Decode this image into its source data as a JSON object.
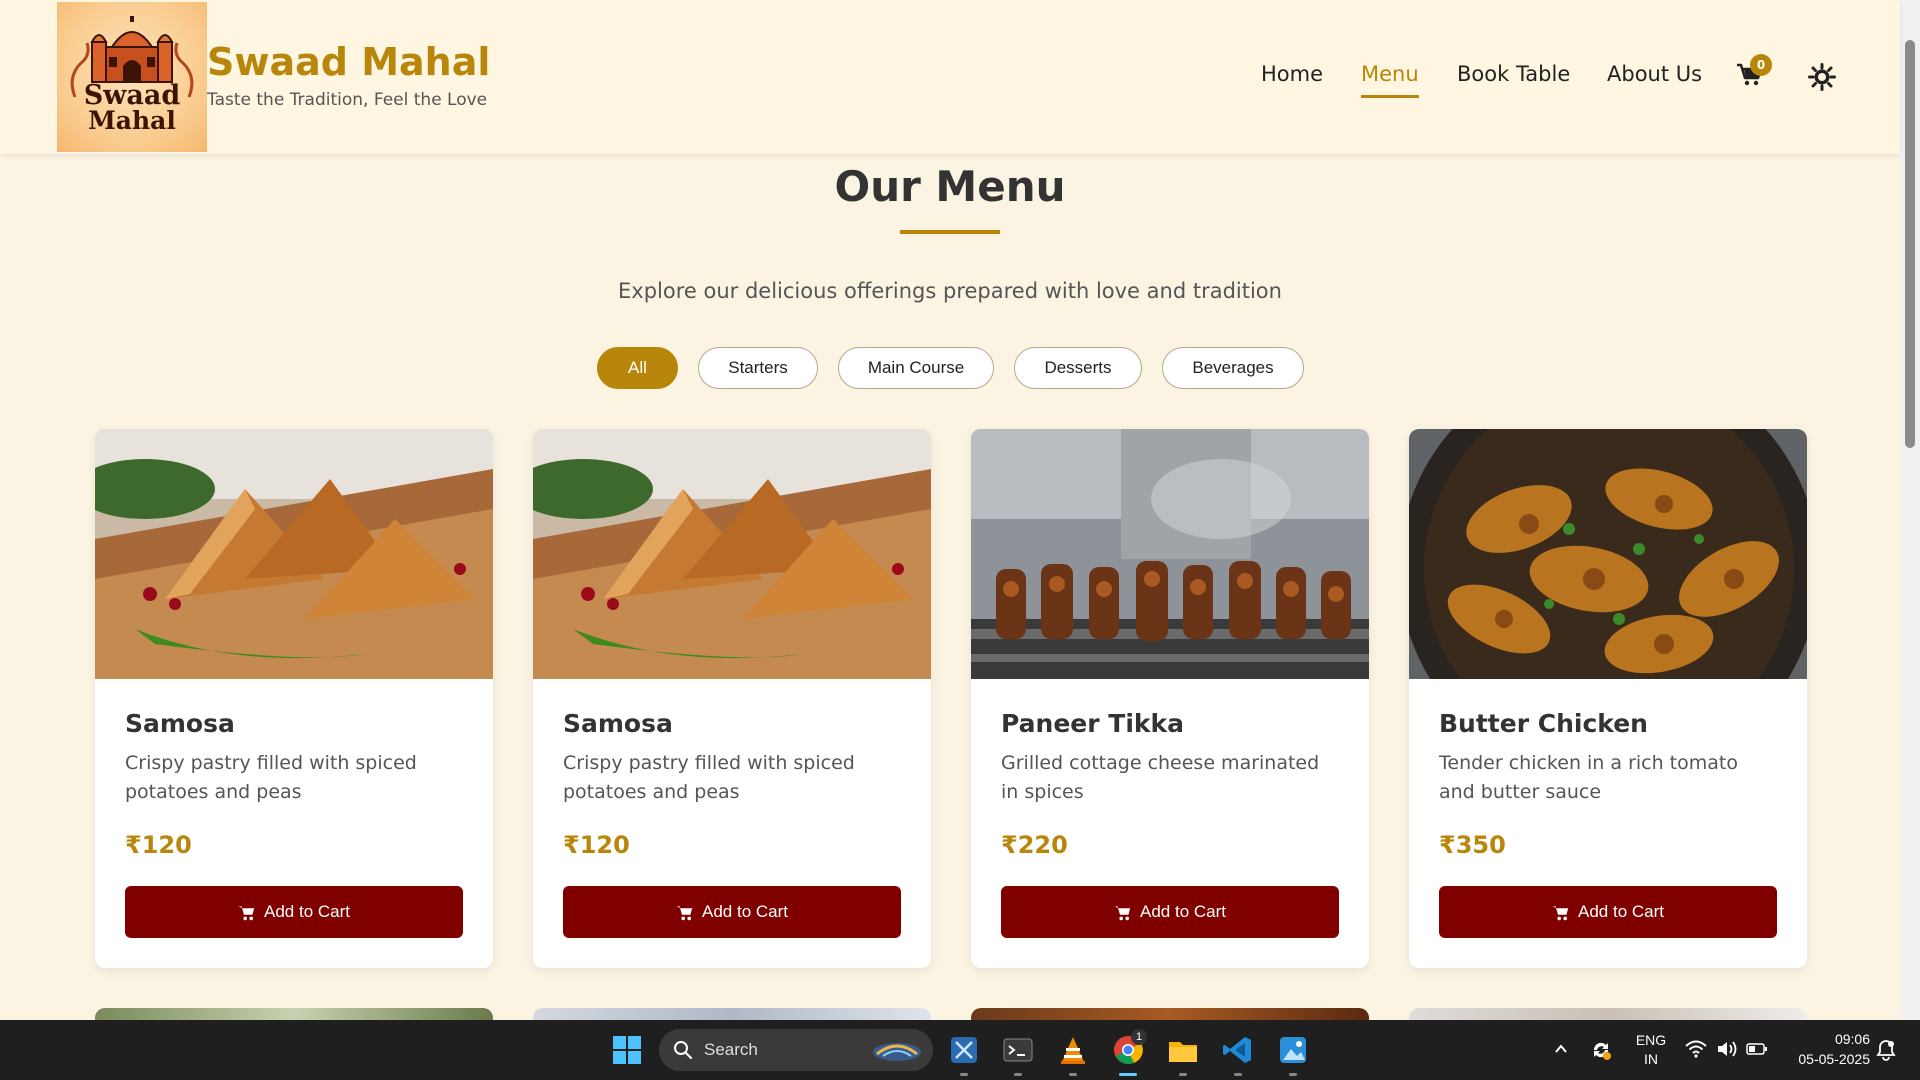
{
  "brand": {
    "logo_line1": "Swaad",
    "logo_line2": "Mahal",
    "name": "Swaad Mahal",
    "tagline": "Taste the Tradition, Feel the Love"
  },
  "nav": {
    "items": [
      {
        "label": "Home"
      },
      {
        "label": "Menu",
        "active": true
      },
      {
        "label": "Book Table"
      },
      {
        "label": "About Us"
      }
    ],
    "cart_count": "0"
  },
  "section": {
    "title": "Our Menu",
    "subtitle": "Explore our delicious offerings prepared with love and tradition"
  },
  "filters": [
    {
      "label": "All",
      "active": true
    },
    {
      "label": "Starters"
    },
    {
      "label": "Main Course"
    },
    {
      "label": "Desserts"
    },
    {
      "label": "Beverages"
    }
  ],
  "cards": [
    {
      "name": "Samosa",
      "description": "Crispy pastry filled with spiced potatoes and peas",
      "price": "₹120",
      "button": "Add to Cart",
      "image": "samosa-photo"
    },
    {
      "name": "Samosa",
      "description": "Crispy pastry filled with spiced potatoes and peas",
      "price": "₹120",
      "button": "Add to Cart",
      "image": "samosa-photo"
    },
    {
      "name": "Paneer Tikka",
      "description": "Grilled cottage cheese marinated in spices",
      "price": "₹220",
      "button": "Add to Cart",
      "image": "paneer-tikka-photo"
    },
    {
      "name": "Butter Chicken",
      "description": "Tender chicken in a rich tomato and butter sauce",
      "price": "₹350",
      "button": "Add to Cart",
      "image": "butter-chicken-photo"
    }
  ],
  "taskbar": {
    "search_label": "Search",
    "language_line1": "ENG",
    "language_line2": "IN",
    "time": "09:06",
    "date": "05-05-2025",
    "chrome_badge": "1"
  },
  "colors": {
    "accent": "#b8860b",
    "button": "#800000",
    "background": "#fcf4e3"
  }
}
